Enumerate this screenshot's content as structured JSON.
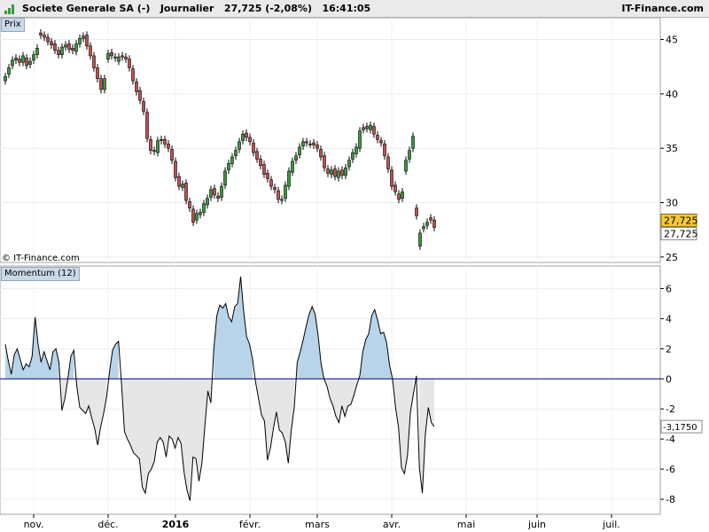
{
  "header": {
    "title": "Societe Generale SA (-)   Journalier   27,725 (-2,08%)   16:41:05",
    "brand": "IT-Finance.com"
  },
  "panels": {
    "price_label": "Prix",
    "momentum_label": "Momentum (12)",
    "copyright": "© IT-Finance.com"
  },
  "colors": {
    "up": "#3a9a3a",
    "down": "#c0504d",
    "positive_fill": "#b8d4ea",
    "negative_fill": "#e6e6e6",
    "last_price_bg": "#f7c934",
    "zero_line": "#00008b"
  },
  "chart_data": [
    {
      "type": "candlestick",
      "title": "Prix",
      "ylim": [
        24.5,
        47
      ],
      "yticks": [
        25,
        30,
        35,
        40,
        45
      ],
      "last_price": "27,725",
      "last_close_label": "27,725",
      "x_labels": [
        {
          "label": "nov.",
          "index": 8
        },
        {
          "label": "déc.",
          "index": 29
        },
        {
          "label": "2016",
          "index": 48
        },
        {
          "label": "févr.",
          "index": 69
        },
        {
          "label": "mars",
          "index": 88
        },
        {
          "label": "avr.",
          "index": 109
        },
        {
          "label": "mai",
          "index": 130
        },
        {
          "label": "juin",
          "index": 150
        },
        {
          "label": "juil.",
          "index": 171
        }
      ],
      "close": [
        41.6,
        42.4,
        43.1,
        43.3,
        42.9,
        43.5,
        42.6,
        43.0,
        43.6,
        44.2,
        45.4,
        45.2,
        44.8,
        44.5,
        44.0,
        43.6,
        44.3,
        44.5,
        44.1,
        44.0,
        44.6,
        45.1,
        45.3,
        44.4,
        43.5,
        42.4,
        41.4,
        40.4,
        41.4,
        43.7,
        43.5,
        43.3,
        43.4,
        43.4,
        43.2,
        42.4,
        41.2,
        40.2,
        39.4,
        38.4,
        35.9,
        34.8,
        34.7,
        35.7,
        35.7,
        35.4,
        35.0,
        33.9,
        32.3,
        31.5,
        31.7,
        30.2,
        29.5,
        28.2,
        29.0,
        29.1,
        29.9,
        30.4,
        31.2,
        30.7,
        30.4,
        31.5,
        32.9,
        33.6,
        34.2,
        34.8,
        35.6,
        36.3,
        36.0,
        35.6,
        34.6,
        34.0,
        33.4,
        32.6,
        32.2,
        31.5,
        31.2,
        30.3,
        30.3,
        31.6,
        32.9,
        33.8,
        34.3,
        35.1,
        35.6,
        35.5,
        35.4,
        35.3,
        35.0,
        34.2,
        33.2,
        32.7,
        33.0,
        32.4,
        32.9,
        32.5,
        33.2,
        33.9,
        34.6,
        35.1,
        36.6,
        36.9,
        36.8,
        37.1,
        36.3,
        35.8,
        35.5,
        34.3,
        33.1,
        31.5,
        31.0,
        30.3,
        31.0,
        33.9,
        34.8,
        36.1,
        28.8,
        27.2,
        27.8,
        28.2,
        28.4,
        27.725
      ],
      "open": [
        41.2,
        41.8,
        42.6,
        43.1,
        43.2,
        42.9,
        43.3,
        42.7,
        43.1,
        43.6,
        45.6,
        45.4,
        45.2,
        44.8,
        44.6,
        44.0,
        43.6,
        44.3,
        44.6,
        44.2,
        43.9,
        44.6,
        45.1,
        45.4,
        44.4,
        43.5,
        42.4,
        41.4,
        40.4,
        43.2,
        43.8,
        43.4,
        43.0,
        43.5,
        43.4,
        43.2,
        42.3,
        41.1,
        40.3,
        39.3,
        38.3,
        35.8,
        34.8,
        34.6,
        35.8,
        35.8,
        35.4,
        34.9,
        33.8,
        32.4,
        31.4,
        31.8,
        30.1,
        29.4,
        28.4,
        28.9,
        29.1,
        29.8,
        30.5,
        31.3,
        30.6,
        30.5,
        31.6,
        33.0,
        33.6,
        34.3,
        34.9,
        35.7,
        36.4,
        36.0,
        35.5,
        34.7,
        34.0,
        33.5,
        32.7,
        32.1,
        31.4,
        31.1,
        30.2,
        30.4,
        31.5,
        32.8,
        33.9,
        34.4,
        35.2,
        35.6,
        35.4,
        35.5,
        35.3,
        34.9,
        34.3,
        33.1,
        32.6,
        33.1,
        32.3,
        33.0,
        32.5,
        33.3,
        34.0,
        34.5,
        35.0,
        36.7,
        37.0,
        36.7,
        37.0,
        36.2,
        35.7,
        35.4,
        34.2,
        33.0,
        31.6,
        30.8,
        30.4,
        32.9,
        34.0,
        35.0,
        29.5,
        26.0,
        27.6,
        27.9,
        28.6,
        28.4
      ]
    },
    {
      "type": "area",
      "title": "Momentum (12)",
      "ylim": [
        -9,
        7.5
      ],
      "yticks": [
        6,
        4,
        2,
        0,
        -2,
        -4,
        -6,
        -8
      ],
      "last_value": "-3,1750",
      "values": [
        2.3,
        1.2,
        0.3,
        1.6,
        2.0,
        1.3,
        0.6,
        1.0,
        0.8,
        1.5,
        4.1,
        2.3,
        1.1,
        1.8,
        1.2,
        0.6,
        1.8,
        2.0,
        1.1,
        -2.1,
        -1.3,
        0.0,
        1.5,
        1.9,
        -0.5,
        -1.9,
        -2.1,
        -2.3,
        -1.8,
        -2.6,
        -3.3,
        -4.4,
        -3.2,
        -2.3,
        -1.2,
        0.5,
        1.9,
        2.3,
        2.5,
        -0.3,
        -3.5,
        -4.0,
        -4.4,
        -4.9,
        -5.1,
        -5.3,
        -7.2,
        -7.6,
        -6.3,
        -6.0,
        -5.5,
        -4.2,
        -3.9,
        -4.2,
        -5.2,
        -3.8,
        -4.0,
        -4.6,
        -3.9,
        -4.3,
        -6.2,
        -7.4,
        -8.1,
        -5.2,
        -5.3,
        -6.8,
        -5.6,
        -3.1,
        -0.8,
        -1.6,
        2.0,
        4.2,
        4.9,
        4.7,
        5.0,
        4.1,
        3.8,
        4.8,
        5.0,
        6.8,
        4.5,
        2.8,
        2.3,
        1.3,
        -0.2,
        -1.3,
        -2.4,
        -2.8,
        -5.4,
        -4.6,
        -3.3,
        -2.2,
        -3.4,
        -3.6,
        -4.2,
        -5.6,
        -3.4,
        -1.9,
        1.1,
        1.8,
        2.6,
        3.5,
        4.3,
        4.8,
        4.3,
        2.9,
        1.0,
        0.0,
        -0.5,
        -1.3,
        -1.8,
        -2.5,
        -2.9,
        -1.8,
        -2.5,
        -1.8,
        -1.7,
        -1.1,
        -0.4,
        0.2,
        1.8,
        2.6,
        3.0,
        4.2,
        4.6,
        3.9,
        3.0,
        3.1,
        2.4,
        0.9,
        0.0,
        -1.9,
        -3.2,
        -5.9,
        -6.3,
        -5.1,
        -2.2,
        -1.0,
        0.2,
        -5.9,
        -7.6,
        -3.7,
        -1.9,
        -2.9,
        -3.175
      ],
      "x_labels": [
        {
          "label": "nov.",
          "index": 8
        },
        {
          "label": "déc.",
          "index": 29
        },
        {
          "label": "2016",
          "index": 48
        },
        {
          "label": "févr.",
          "index": 69
        },
        {
          "label": "mars",
          "index": 88
        },
        {
          "label": "avr.",
          "index": 109
        },
        {
          "label": "mai",
          "index": 130
        },
        {
          "label": "juin",
          "index": 150
        },
        {
          "label": "juil.",
          "index": 171
        }
      ]
    }
  ]
}
